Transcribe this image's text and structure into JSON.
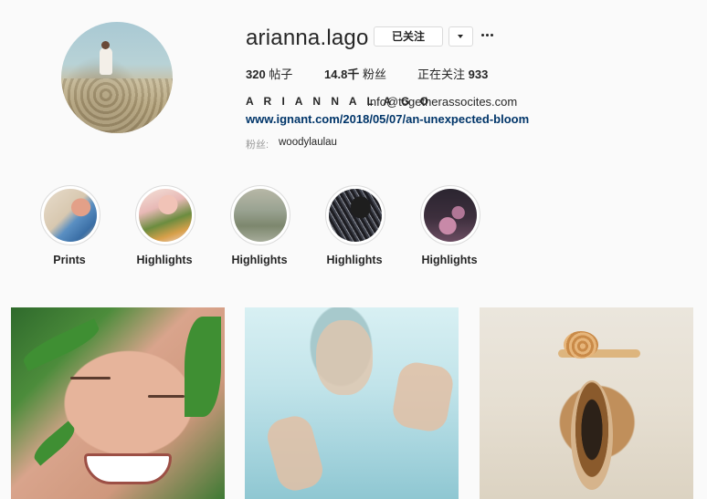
{
  "profile": {
    "username": "arianna.lago",
    "follow_label": "已关注",
    "stats": {
      "posts_value": "320",
      "posts_label": "帖子",
      "followers_value": "14.8千",
      "followers_label": "粉丝",
      "following_label": "正在关注",
      "following_value": "933"
    },
    "full_name": "A R I A N N A L A G O",
    "email": "info@togetherassocites.com",
    "link": "www.ignant.com/2018/05/07/an-unexpected-bloom",
    "followed_by_label": "粉丝:",
    "followed_by_name": "woodylaulau"
  },
  "highlights": [
    {
      "label": "Prints"
    },
    {
      "label": "Highlights"
    },
    {
      "label": "Highlights"
    },
    {
      "label": "Highlights"
    },
    {
      "label": "Highlights"
    }
  ],
  "icons": {
    "dropdown": "chevron-down-icon",
    "more": "more-options-icon"
  }
}
